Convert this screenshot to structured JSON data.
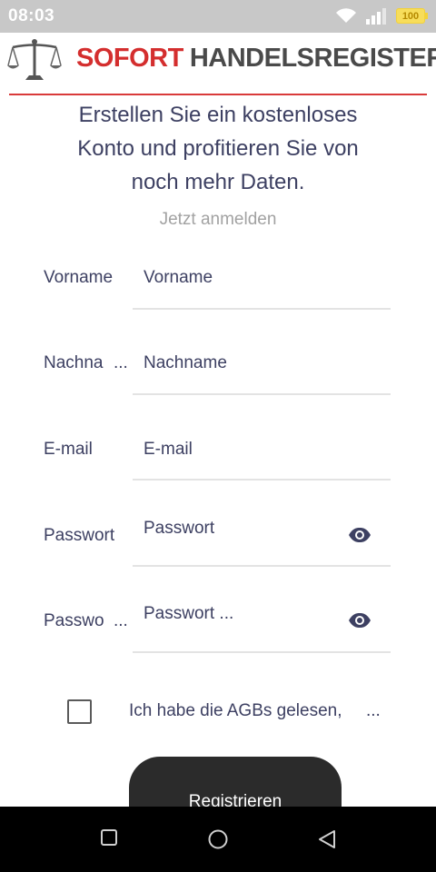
{
  "status_bar": {
    "time": "08:03",
    "battery": "100",
    "icons": [
      "wifi-icon",
      "signal-icon",
      "battery-icon"
    ]
  },
  "header": {
    "logo_word1": "SOFORT",
    "logo_word2": "HANDELSREGISTER",
    "logo_icon": "scales-icon",
    "colors": {
      "brand_red": "#d42e2e",
      "brand_gray": "#4a4a4a"
    }
  },
  "intro": {
    "line1": "Erstellen Sie ein kostenloses",
    "line2": "Konto und profitieren Sie von",
    "line3": "noch mehr Daten.",
    "login_link": "Jetzt anmelden"
  },
  "form": {
    "fields": [
      {
        "label": "Vorname",
        "placeholder": "Vorname"
      },
      {
        "label": "Nachna",
        "label_more": "...",
        "placeholder": "Nachname"
      },
      {
        "label": "E-mail",
        "placeholder": "E-mail"
      },
      {
        "label": "Passwort",
        "placeholder": "Passwort",
        "icon": "eye-icon"
      },
      {
        "label": "Passwo",
        "label_more": "...",
        "placeholder": "Passwort ...",
        "icon": "eye-icon"
      }
    ],
    "agb_text": "Ich habe die AGBs gelesen,",
    "agb_more": "...",
    "agb_checked": false,
    "submit_label": "Registrieren"
  },
  "nav_bar": {
    "icons": [
      "recents-square-icon",
      "home-circle-icon",
      "back-triangle-icon"
    ]
  },
  "colors": {
    "text": "#3d4062",
    "muted": "#a2a2a2",
    "button_bg": "#2b2b2b"
  }
}
